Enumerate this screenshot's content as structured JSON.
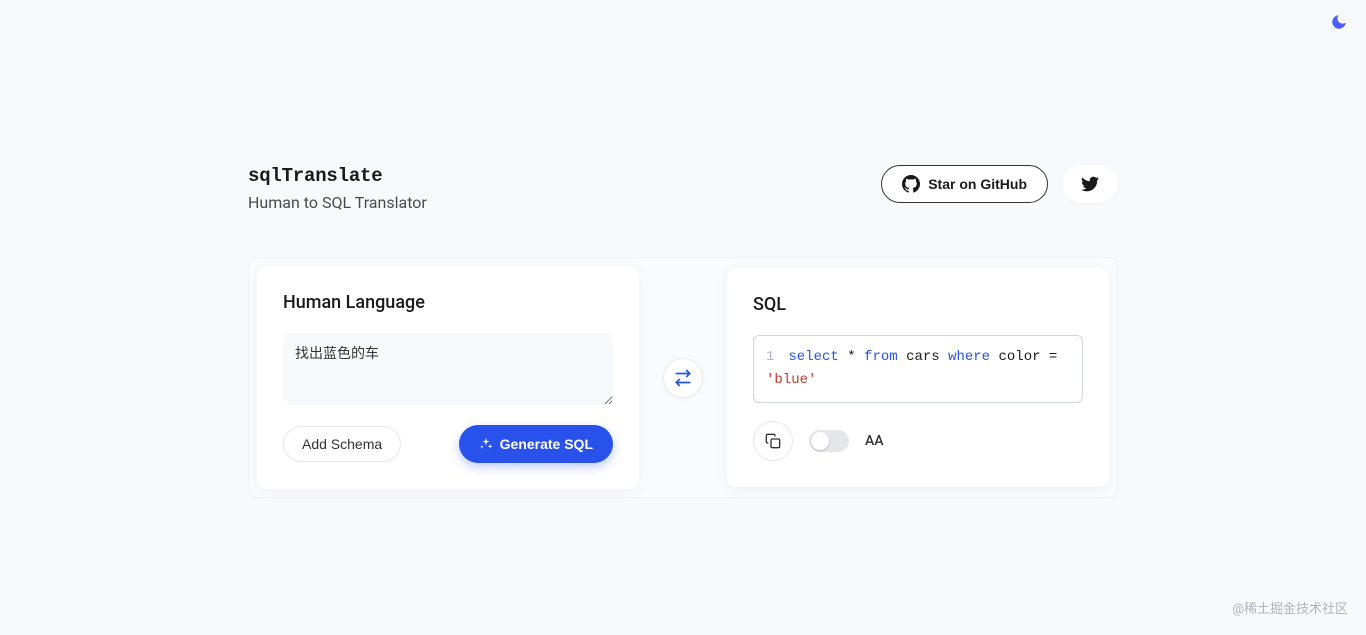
{
  "header": {
    "title": "sqlTranslate",
    "subtitle": "Human to SQL Translator",
    "github_label": "Star on GitHub"
  },
  "input_card": {
    "title": "Human Language",
    "text_value": "找出蓝色的车",
    "schema_button": "Add Schema",
    "generate_button": "Generate SQL"
  },
  "output_card": {
    "title": "SQL",
    "line_number": "1",
    "sql_tokens": {
      "select": "select",
      "star": "*",
      "from": "from",
      "table": "cars",
      "where": "where",
      "col": "color",
      "eq": "=",
      "val": "'blue'"
    },
    "uppercase_label": "AA"
  },
  "watermark": "@稀土掘金技术社区"
}
